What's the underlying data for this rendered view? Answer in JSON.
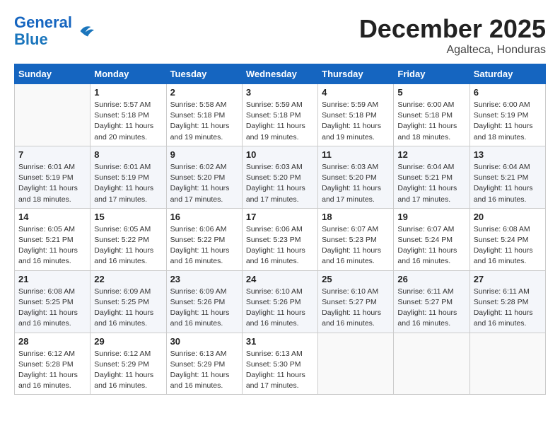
{
  "header": {
    "logo_line1": "General",
    "logo_line2": "Blue",
    "month": "December 2025",
    "location": "Agalteca, Honduras"
  },
  "weekdays": [
    "Sunday",
    "Monday",
    "Tuesday",
    "Wednesday",
    "Thursday",
    "Friday",
    "Saturday"
  ],
  "weeks": [
    [
      {
        "day": "",
        "info": ""
      },
      {
        "day": "1",
        "info": "Sunrise: 5:57 AM\nSunset: 5:18 PM\nDaylight: 11 hours\nand 20 minutes."
      },
      {
        "day": "2",
        "info": "Sunrise: 5:58 AM\nSunset: 5:18 PM\nDaylight: 11 hours\nand 19 minutes."
      },
      {
        "day": "3",
        "info": "Sunrise: 5:59 AM\nSunset: 5:18 PM\nDaylight: 11 hours\nand 19 minutes."
      },
      {
        "day": "4",
        "info": "Sunrise: 5:59 AM\nSunset: 5:18 PM\nDaylight: 11 hours\nand 19 minutes."
      },
      {
        "day": "5",
        "info": "Sunrise: 6:00 AM\nSunset: 5:18 PM\nDaylight: 11 hours\nand 18 minutes."
      },
      {
        "day": "6",
        "info": "Sunrise: 6:00 AM\nSunset: 5:19 PM\nDaylight: 11 hours\nand 18 minutes."
      }
    ],
    [
      {
        "day": "7",
        "info": "Sunrise: 6:01 AM\nSunset: 5:19 PM\nDaylight: 11 hours\nand 18 minutes."
      },
      {
        "day": "8",
        "info": "Sunrise: 6:01 AM\nSunset: 5:19 PM\nDaylight: 11 hours\nand 17 minutes."
      },
      {
        "day": "9",
        "info": "Sunrise: 6:02 AM\nSunset: 5:20 PM\nDaylight: 11 hours\nand 17 minutes."
      },
      {
        "day": "10",
        "info": "Sunrise: 6:03 AM\nSunset: 5:20 PM\nDaylight: 11 hours\nand 17 minutes."
      },
      {
        "day": "11",
        "info": "Sunrise: 6:03 AM\nSunset: 5:20 PM\nDaylight: 11 hours\nand 17 minutes."
      },
      {
        "day": "12",
        "info": "Sunrise: 6:04 AM\nSunset: 5:21 PM\nDaylight: 11 hours\nand 17 minutes."
      },
      {
        "day": "13",
        "info": "Sunrise: 6:04 AM\nSunset: 5:21 PM\nDaylight: 11 hours\nand 16 minutes."
      }
    ],
    [
      {
        "day": "14",
        "info": "Sunrise: 6:05 AM\nSunset: 5:21 PM\nDaylight: 11 hours\nand 16 minutes."
      },
      {
        "day": "15",
        "info": "Sunrise: 6:05 AM\nSunset: 5:22 PM\nDaylight: 11 hours\nand 16 minutes."
      },
      {
        "day": "16",
        "info": "Sunrise: 6:06 AM\nSunset: 5:22 PM\nDaylight: 11 hours\nand 16 minutes."
      },
      {
        "day": "17",
        "info": "Sunrise: 6:06 AM\nSunset: 5:23 PM\nDaylight: 11 hours\nand 16 minutes."
      },
      {
        "day": "18",
        "info": "Sunrise: 6:07 AM\nSunset: 5:23 PM\nDaylight: 11 hours\nand 16 minutes."
      },
      {
        "day": "19",
        "info": "Sunrise: 6:07 AM\nSunset: 5:24 PM\nDaylight: 11 hours\nand 16 minutes."
      },
      {
        "day": "20",
        "info": "Sunrise: 6:08 AM\nSunset: 5:24 PM\nDaylight: 11 hours\nand 16 minutes."
      }
    ],
    [
      {
        "day": "21",
        "info": "Sunrise: 6:08 AM\nSunset: 5:25 PM\nDaylight: 11 hours\nand 16 minutes."
      },
      {
        "day": "22",
        "info": "Sunrise: 6:09 AM\nSunset: 5:25 PM\nDaylight: 11 hours\nand 16 minutes."
      },
      {
        "day": "23",
        "info": "Sunrise: 6:09 AM\nSunset: 5:26 PM\nDaylight: 11 hours\nand 16 minutes."
      },
      {
        "day": "24",
        "info": "Sunrise: 6:10 AM\nSunset: 5:26 PM\nDaylight: 11 hours\nand 16 minutes."
      },
      {
        "day": "25",
        "info": "Sunrise: 6:10 AM\nSunset: 5:27 PM\nDaylight: 11 hours\nand 16 minutes."
      },
      {
        "day": "26",
        "info": "Sunrise: 6:11 AM\nSunset: 5:27 PM\nDaylight: 11 hours\nand 16 minutes."
      },
      {
        "day": "27",
        "info": "Sunrise: 6:11 AM\nSunset: 5:28 PM\nDaylight: 11 hours\nand 16 minutes."
      }
    ],
    [
      {
        "day": "28",
        "info": "Sunrise: 6:12 AM\nSunset: 5:28 PM\nDaylight: 11 hours\nand 16 minutes."
      },
      {
        "day": "29",
        "info": "Sunrise: 6:12 AM\nSunset: 5:29 PM\nDaylight: 11 hours\nand 16 minutes."
      },
      {
        "day": "30",
        "info": "Sunrise: 6:13 AM\nSunset: 5:29 PM\nDaylight: 11 hours\nand 16 minutes."
      },
      {
        "day": "31",
        "info": "Sunrise: 6:13 AM\nSunset: 5:30 PM\nDaylight: 11 hours\nand 17 minutes."
      },
      {
        "day": "",
        "info": ""
      },
      {
        "day": "",
        "info": ""
      },
      {
        "day": "",
        "info": ""
      }
    ]
  ]
}
